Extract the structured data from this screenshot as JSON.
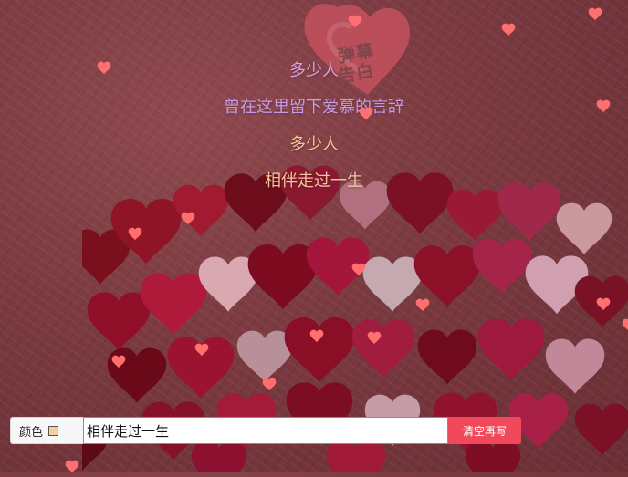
{
  "app": {
    "logo_text_line1": "弹幕",
    "logo_text_line2": "告白"
  },
  "danmaku": [
    {
      "text": "多少人",
      "color": "#d9a0e0"
    },
    {
      "text": "曾在这里留下爱慕的言辞",
      "color": "#c99be6"
    },
    {
      "text": "多少人",
      "color": "#f1c79a"
    },
    {
      "text": "相伴走过一生",
      "color": "#f1c79a"
    }
  ],
  "controls": {
    "color_label": "颜色",
    "color_value": "#f5cfa0",
    "input_value": "相伴走过一生",
    "clear_button": "清空再写"
  },
  "icons": {
    "floating": "heart-icon",
    "accent": "#ff6f6f"
  }
}
